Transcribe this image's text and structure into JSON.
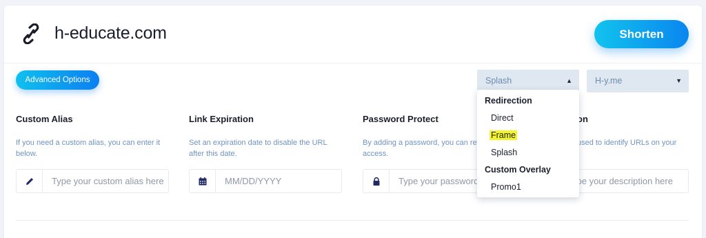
{
  "header": {
    "url_title": "h-educate.com",
    "shorten_label": "Shorten"
  },
  "advanced_options_label": "Advanced Options",
  "redirect_select": {
    "selected": "Splash",
    "groups": [
      {
        "label": "Redirection",
        "items": [
          "Direct",
          "Frame",
          "Splash"
        ]
      },
      {
        "label": "Custom Overlay",
        "items": [
          "Promo1"
        ]
      }
    ],
    "highlighted_item": "Frame"
  },
  "domain_select": {
    "selected": "H-y.me"
  },
  "fields": {
    "alias": {
      "title": "Custom Alias",
      "help": "If you need a custom alias, you can enter it below.",
      "placeholder": "Type your custom alias here"
    },
    "expiration": {
      "title": "Link Expiration",
      "help": "Set an expiration date to disable the URL after this date.",
      "placeholder": "MM/DD/YYYY"
    },
    "password": {
      "title": "Password Protect",
      "help": "By adding a password, you can restrict the access.",
      "placeholder": "Type your password here"
    },
    "description": {
      "title": "on",
      "help": "used to identify URLs on your",
      "placeholder": "ype your description here"
    }
  },
  "colors": {
    "accent_start": "#12c3ee",
    "accent_end": "#0a86ef",
    "help_text": "#6f93c0",
    "select_bg": "#dfe7f1",
    "highlight": "#f4f42c"
  },
  "icons": {
    "url": "link-icon",
    "alias": "pencil-icon",
    "expiration": "calendar-icon",
    "password": "lock-icon",
    "caret_up": "caret-up-icon",
    "caret_down": "caret-down-icon"
  }
}
